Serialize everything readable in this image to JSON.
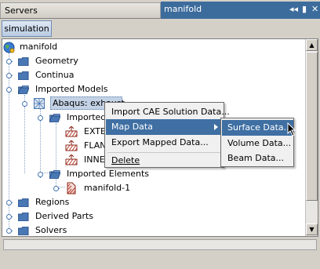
{
  "tabs": {
    "servers_label": "Servers",
    "manifold_label": "manifold"
  },
  "toolbar": {
    "simulation_label": "simulation"
  },
  "tree": {
    "root": "manifold",
    "geometry": "Geometry",
    "continua": "Continua",
    "imported_models": "Imported Models",
    "abaqus": "Abaqus: exhaust",
    "imported_surfaces": "Imported Surfaces",
    "exter": "EXTERIOR",
    "flange": "FLANGE",
    "inner": "INNER",
    "imported_elements": "Imported Elements",
    "manifold1": "manifold-1",
    "regions": "Regions",
    "derived_parts": "Derived Parts",
    "solvers": "Solvers"
  },
  "context_menu": {
    "items": [
      "Import CAE Solution Data...",
      "Map Data",
      "Export Mapped Data...",
      "Delete"
    ]
  },
  "submenu": {
    "items": [
      "Surface Data...",
      "Volume Data...",
      "Beam Data..."
    ]
  },
  "colors": {
    "accent": "#3f6fa3",
    "folder": "#4a78b4",
    "active_tab": "#3c6c9c"
  }
}
